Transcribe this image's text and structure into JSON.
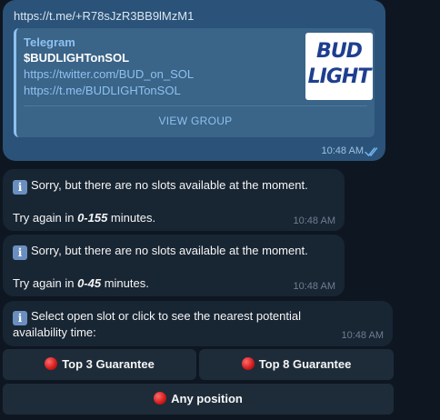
{
  "outgoing": {
    "link": "https://t.me/+R78sJzR3BB9lMzM1",
    "preview": {
      "site": "Telegram",
      "title": "$BUDLIGHTonSOL",
      "link1": "https://twitter.com/BUD_on_SOL",
      "link2": "https://t.me/BUDLIGHTonSOL",
      "thumb_line1": "BUD",
      "thumb_line2": "LIGHT",
      "button": "VIEW GROUP"
    },
    "time": "10:48 AM"
  },
  "messages": [
    {
      "icon": "i",
      "text": "Sorry, but there are no slots available at the moment.",
      "retry_prefix": "Try again in ",
      "retry_range": "0-155",
      "retry_suffix": " minutes.",
      "time": "10:48 AM"
    },
    {
      "icon": "i",
      "text": "Sorry, but there are no slots available at the moment.",
      "retry_prefix": "Try again in ",
      "retry_range": "0-45",
      "retry_suffix": " minutes.",
      "time": "10:48 AM"
    }
  ],
  "select": {
    "icon": "i",
    "line1": "Select open slot or click to see the nearest potential",
    "line2": "availability time:",
    "time": "10:48 AM"
  },
  "keyboard": {
    "btn1": "Top 3 Guarantee",
    "btn2": "Top 8 Guarantee",
    "btn3": "Any position"
  },
  "colors": {
    "background": "#0e1621",
    "outgoing_bubble": "#2b5278",
    "incoming_bubble": "#182533",
    "link": "#8ec1ef",
    "status_dot": "#d11a1a"
  }
}
